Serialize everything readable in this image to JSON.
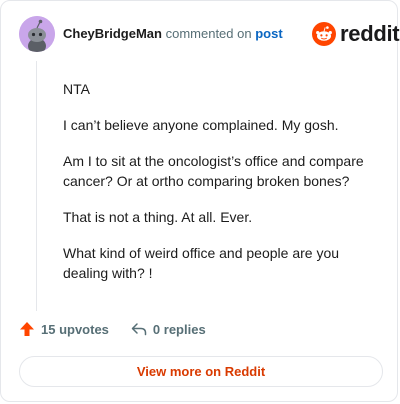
{
  "header": {
    "author": "CheyBridgeMan",
    "action": "commented on",
    "post_link": "post",
    "logo_text": "reddit"
  },
  "comment": {
    "paragraphs": [
      "NTA",
      "I can’t believe anyone complained. My gosh.",
      "Am I to sit at the oncologist’s office and compare cancer? Or at ortho comparing broken bones?",
      "That is not a thing. At all. Ever.",
      "What kind of weird office and people are you dealing with? !"
    ]
  },
  "actions": {
    "upvotes": "15 upvotes",
    "replies": "0 replies"
  },
  "footer": {
    "view_more": "View more on Reddit"
  },
  "colors": {
    "brand": "#ff4500",
    "upvote": "#ff4500",
    "view_more_text": "#d93a00",
    "avatar_bg": "#c9a6ea"
  },
  "icons": {
    "avatar": "snoo-avatar-icon",
    "logo": "reddit-snoo-icon",
    "upvote": "upvote-arrow-icon",
    "reply": "reply-arrow-icon"
  }
}
